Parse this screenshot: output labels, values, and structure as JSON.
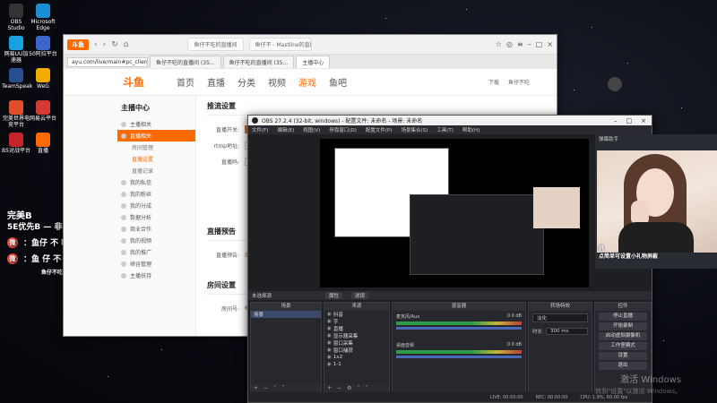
{
  "desktop": {
    "icons": [
      {
        "label": "OBS Studio",
        "color": "#333"
      },
      {
        "label": "Microsoft Edge",
        "color": "#1a8fd1"
      },
      {
        "label": "网易UU加速器",
        "color": "#18a0e0"
      },
      {
        "label": "50阿拉平台",
        "color": "#3a66c9"
      },
      {
        "label": "TeamSpeak",
        "color": "#2b4e8e"
      },
      {
        "label": "WeG",
        "color": "#f2a900"
      },
      {
        "label": "完美世界电竞平台",
        "color": "#e0502a"
      },
      {
        "label": "网易云平台",
        "color": "#d43c33"
      },
      {
        "label": "B5对战平台",
        "color": "#c3252a"
      },
      {
        "label": "直播",
        "color": "#ff6a00"
      }
    ]
  },
  "overlay": {
    "line1": "完美B",
    "line2": "5E优先B — 非优先2739",
    "weibo1": "：鱼仔 不 吃",
    "weibo2": "：鱼 仔 不 吃",
    "wechat": "鱼仔不吃小鱼"
  },
  "browser": {
    "logo": "斗鱼",
    "url": "ayu.com/live/main#pc_client",
    "mini_tab1": "鱼仔不吃的直播间",
    "mini_tab2": "鱼仔不 - Mastline的直播间",
    "tabs": [
      "鱼仔不吃的直播间 (35...",
      "鱼仔不吃的直播间 (35...",
      "主播中心"
    ],
    "site_logo": "斗鱼",
    "nav": [
      "首页",
      "直播",
      "分类",
      "视频",
      "游戏",
      "鱼吧"
    ],
    "download": "下载",
    "user": "鱼仔不吃",
    "sidebar_title": "主播中心",
    "sidebar": [
      {
        "label": "主播相关",
        "type": "item"
      },
      {
        "label": "直播相关",
        "type": "sel"
      },
      {
        "label": "房间管理",
        "type": "sub"
      },
      {
        "label": "直播设置",
        "type": "subhl"
      },
      {
        "label": "直播记录",
        "type": "sub"
      },
      {
        "label": "我的私信",
        "type": "item"
      },
      {
        "label": "我的粉丝",
        "type": "item"
      },
      {
        "label": "我的分成",
        "type": "item"
      },
      {
        "label": "数据分析",
        "type": "item"
      },
      {
        "label": "商业合作",
        "type": "item"
      },
      {
        "label": "我的视频",
        "type": "item"
      },
      {
        "label": "我的推广",
        "type": "item"
      },
      {
        "label": "峡谷管理",
        "type": "item"
      },
      {
        "label": "主播扶持",
        "type": "item"
      }
    ],
    "section1": "推流设置",
    "form": [
      {
        "label": "直播开关:",
        "value": ""
      },
      {
        "label": "rtmp地址:",
        "value": "rtm"
      },
      {
        "label": "直播码:",
        "value": "Ho"
      }
    ],
    "section2": "直播预告",
    "notice_label": "直播预告:",
    "notice_value": "面向",
    "section3": "房间设置",
    "room_label": "房间号:",
    "room_value": "6495"
  },
  "obs": {
    "title": "OBS 27.2.4 (32-bit, windows) - 配置文件: 未命名 - 场景: 未命名",
    "menu": [
      "文件(F)",
      "编辑(E)",
      "视图(V)",
      "停靠窗口(D)",
      "配置文件(P)",
      "场景集合(S)",
      "工具(T)",
      "帮助(H)"
    ],
    "scene_bar_label": "未选择源",
    "scene_btn1": "属性",
    "scene_btn2": "滤镜",
    "docks": {
      "scenes": {
        "title": "场景",
        "items": [
          "场景"
        ]
      },
      "sources": {
        "title": "来源",
        "items": [
          "抖音",
          "字",
          "直播",
          "显示器采集",
          "窗口采集",
          "窗口捕获",
          "1x2",
          "1-1"
        ]
      },
      "mixer": {
        "title": "混音器",
        "channels": [
          {
            "name": "麦克风/Aux",
            "db": "0.0 dB"
          },
          {
            "name": "桌面音频",
            "db": "0.0 dB"
          }
        ]
      },
      "transitions": {
        "title": "转场特效",
        "type": "淡化",
        "duration_label": "时长",
        "duration": "300 ms"
      },
      "controls": {
        "title": "控件",
        "buttons": [
          "停止直播",
          "开始录制",
          "启动虚拟摄像机",
          "工作室模式",
          "设置",
          "退出"
        ]
      }
    },
    "status": [
      "LIVE: 00:00:00",
      "REC: 00:00:00",
      "CPU: 1.9%, 60.00 fps"
    ]
  },
  "camera": {
    "header": "弹幕助手",
    "caption_line1": "挑",
    "caption_line2": "点简单可设置小礼物屏蔽"
  },
  "watermark": {
    "line1": "激活 Windows",
    "line2": "转到\"设置\"以激活 Windows。"
  }
}
